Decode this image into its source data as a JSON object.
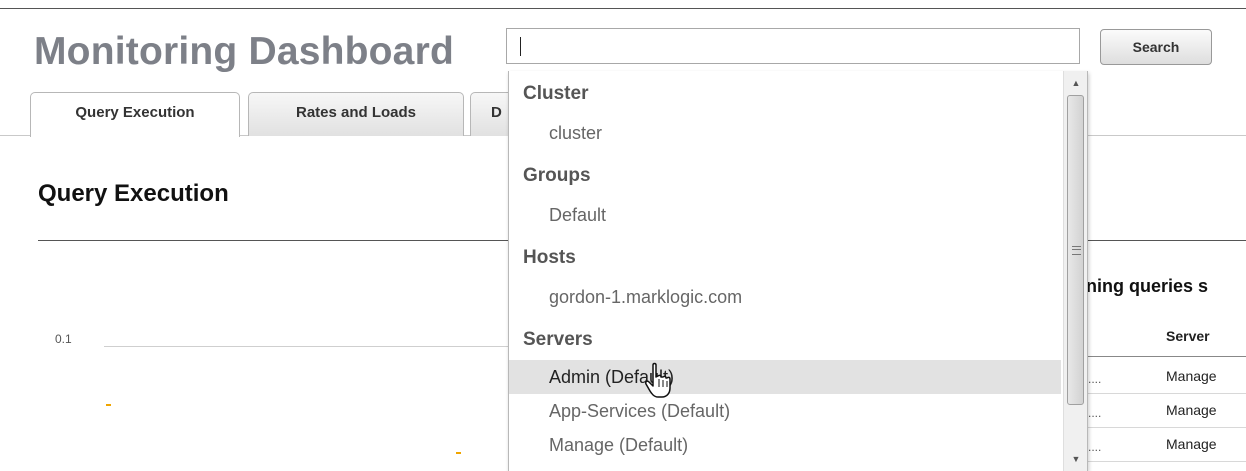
{
  "header": {
    "title": "Monitoring Dashboard",
    "search": {
      "value": "",
      "placeholder": ""
    },
    "search_label": "Search"
  },
  "tabs": [
    {
      "label": "Query Execution",
      "active": true
    },
    {
      "label": "Rates and Loads",
      "active": false
    },
    {
      "label": "D",
      "active": false
    }
  ],
  "section": {
    "title": "Query Execution"
  },
  "chart": {
    "y_ticks": [
      "0.1"
    ]
  },
  "chart_data": {
    "type": "scatter",
    "title": "",
    "xlabel": "",
    "ylabel": "",
    "y_ticks": [
      0.1
    ],
    "series": [
      {
        "points": [
          [
            1,
            0.07
          ],
          [
            2,
            0.02
          ]
        ],
        "color": "#f0a500"
      }
    ]
  },
  "running_queries": {
    "heading": "ning queries s",
    "columns": [
      "Server"
    ],
    "rows": [
      {
        "prefix": "....",
        "server": "Manage"
      },
      {
        "prefix": "....",
        "server": "Manage"
      },
      {
        "prefix": "....",
        "server": "Manage"
      }
    ]
  },
  "dropdown": {
    "groups": [
      {
        "label": "Cluster",
        "items": [
          "cluster"
        ]
      },
      {
        "label": "Groups",
        "items": [
          "Default"
        ]
      },
      {
        "label": "Hosts",
        "items": [
          "gordon-1.marklogic.com"
        ]
      },
      {
        "label": "Servers",
        "items": [
          "Admin (Default)",
          "App-Services (Default)",
          "Manage (Default)"
        ]
      }
    ],
    "hovered_item": "Admin (Default)"
  },
  "icons": {
    "scroll_up": "scroll-up-arrow-icon",
    "scroll_down": "scroll-down-arrow-icon",
    "cursor": "hand-pointer-cursor-icon"
  }
}
